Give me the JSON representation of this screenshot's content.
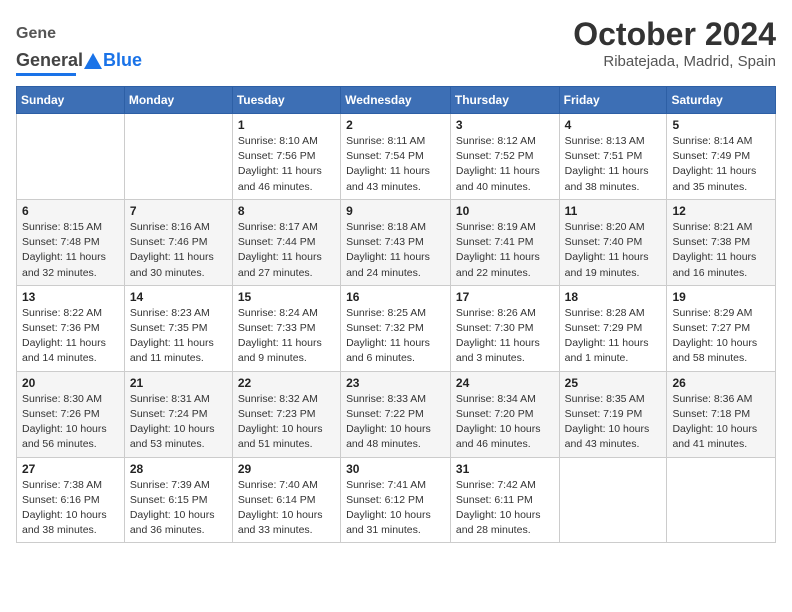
{
  "header": {
    "logo_general": "General",
    "logo_blue": "Blue",
    "title": "October 2024",
    "subtitle": "Ribatejada, Madrid, Spain"
  },
  "days_of_week": [
    "Sunday",
    "Monday",
    "Tuesday",
    "Wednesday",
    "Thursday",
    "Friday",
    "Saturday"
  ],
  "weeks": [
    [
      {
        "day": "",
        "info": ""
      },
      {
        "day": "",
        "info": ""
      },
      {
        "day": "1",
        "info": "Sunrise: 8:10 AM\nSunset: 7:56 PM\nDaylight: 11 hours and 46 minutes."
      },
      {
        "day": "2",
        "info": "Sunrise: 8:11 AM\nSunset: 7:54 PM\nDaylight: 11 hours and 43 minutes."
      },
      {
        "day": "3",
        "info": "Sunrise: 8:12 AM\nSunset: 7:52 PM\nDaylight: 11 hours and 40 minutes."
      },
      {
        "day": "4",
        "info": "Sunrise: 8:13 AM\nSunset: 7:51 PM\nDaylight: 11 hours and 38 minutes."
      },
      {
        "day": "5",
        "info": "Sunrise: 8:14 AM\nSunset: 7:49 PM\nDaylight: 11 hours and 35 minutes."
      }
    ],
    [
      {
        "day": "6",
        "info": "Sunrise: 8:15 AM\nSunset: 7:48 PM\nDaylight: 11 hours and 32 minutes."
      },
      {
        "day": "7",
        "info": "Sunrise: 8:16 AM\nSunset: 7:46 PM\nDaylight: 11 hours and 30 minutes."
      },
      {
        "day": "8",
        "info": "Sunrise: 8:17 AM\nSunset: 7:44 PM\nDaylight: 11 hours and 27 minutes."
      },
      {
        "day": "9",
        "info": "Sunrise: 8:18 AM\nSunset: 7:43 PM\nDaylight: 11 hours and 24 minutes."
      },
      {
        "day": "10",
        "info": "Sunrise: 8:19 AM\nSunset: 7:41 PM\nDaylight: 11 hours and 22 minutes."
      },
      {
        "day": "11",
        "info": "Sunrise: 8:20 AM\nSunset: 7:40 PM\nDaylight: 11 hours and 19 minutes."
      },
      {
        "day": "12",
        "info": "Sunrise: 8:21 AM\nSunset: 7:38 PM\nDaylight: 11 hours and 16 minutes."
      }
    ],
    [
      {
        "day": "13",
        "info": "Sunrise: 8:22 AM\nSunset: 7:36 PM\nDaylight: 11 hours and 14 minutes."
      },
      {
        "day": "14",
        "info": "Sunrise: 8:23 AM\nSunset: 7:35 PM\nDaylight: 11 hours and 11 minutes."
      },
      {
        "day": "15",
        "info": "Sunrise: 8:24 AM\nSunset: 7:33 PM\nDaylight: 11 hours and 9 minutes."
      },
      {
        "day": "16",
        "info": "Sunrise: 8:25 AM\nSunset: 7:32 PM\nDaylight: 11 hours and 6 minutes."
      },
      {
        "day": "17",
        "info": "Sunrise: 8:26 AM\nSunset: 7:30 PM\nDaylight: 11 hours and 3 minutes."
      },
      {
        "day": "18",
        "info": "Sunrise: 8:28 AM\nSunset: 7:29 PM\nDaylight: 11 hours and 1 minute."
      },
      {
        "day": "19",
        "info": "Sunrise: 8:29 AM\nSunset: 7:27 PM\nDaylight: 10 hours and 58 minutes."
      }
    ],
    [
      {
        "day": "20",
        "info": "Sunrise: 8:30 AM\nSunset: 7:26 PM\nDaylight: 10 hours and 56 minutes."
      },
      {
        "day": "21",
        "info": "Sunrise: 8:31 AM\nSunset: 7:24 PM\nDaylight: 10 hours and 53 minutes."
      },
      {
        "day": "22",
        "info": "Sunrise: 8:32 AM\nSunset: 7:23 PM\nDaylight: 10 hours and 51 minutes."
      },
      {
        "day": "23",
        "info": "Sunrise: 8:33 AM\nSunset: 7:22 PM\nDaylight: 10 hours and 48 minutes."
      },
      {
        "day": "24",
        "info": "Sunrise: 8:34 AM\nSunset: 7:20 PM\nDaylight: 10 hours and 46 minutes."
      },
      {
        "day": "25",
        "info": "Sunrise: 8:35 AM\nSunset: 7:19 PM\nDaylight: 10 hours and 43 minutes."
      },
      {
        "day": "26",
        "info": "Sunrise: 8:36 AM\nSunset: 7:18 PM\nDaylight: 10 hours and 41 minutes."
      }
    ],
    [
      {
        "day": "27",
        "info": "Sunrise: 7:38 AM\nSunset: 6:16 PM\nDaylight: 10 hours and 38 minutes."
      },
      {
        "day": "28",
        "info": "Sunrise: 7:39 AM\nSunset: 6:15 PM\nDaylight: 10 hours and 36 minutes."
      },
      {
        "day": "29",
        "info": "Sunrise: 7:40 AM\nSunset: 6:14 PM\nDaylight: 10 hours and 33 minutes."
      },
      {
        "day": "30",
        "info": "Sunrise: 7:41 AM\nSunset: 6:12 PM\nDaylight: 10 hours and 31 minutes."
      },
      {
        "day": "31",
        "info": "Sunrise: 7:42 AM\nSunset: 6:11 PM\nDaylight: 10 hours and 28 minutes."
      },
      {
        "day": "",
        "info": ""
      },
      {
        "day": "",
        "info": ""
      }
    ]
  ]
}
